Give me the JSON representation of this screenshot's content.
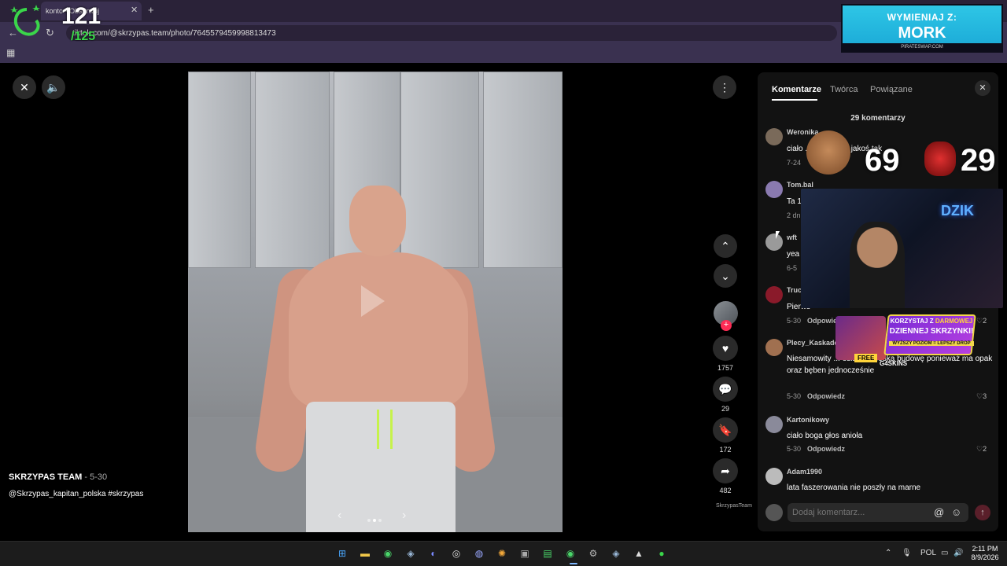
{
  "browser": {
    "tab_title": "konto • Obserwuj",
    "url": "tiktok.com/@skrzypas.team/photo/7645579459998813473"
  },
  "overlay_counter": {
    "big": "121",
    "small": "/125"
  },
  "banner": {
    "line1": "WYMIENIAJ Z:",
    "line2": "MORK",
    "footer": "PIRATESWAP.COM"
  },
  "post": {
    "author": "SKRZYPAS TEAM",
    "date": " - 5-30",
    "caption": "@Skrzypas_kapitan_polska #skrzypas"
  },
  "actions": {
    "likes": "1757",
    "comments": "29",
    "saves": "172",
    "shares": "482",
    "music_label": "SkrzypasTeam"
  },
  "panel": {
    "tabs": [
      "Komentarze",
      "Twórca",
      "Powiązane"
    ],
    "count": "29 komentarzy",
    "reply_label": "Odpowiedz",
    "input_placeholder": "Dodaj komentarz...",
    "comments": [
      {
        "user": "Weronika",
        "text": "ciało ... anioła czy jakoś tak",
        "meta": "7-24",
        "likes": ""
      },
      {
        "user": "Tom.bal",
        "text": "Ta 1",
        "meta": "2 dni",
        "likes": ""
      },
      {
        "user": "wft",
        "text": "yea",
        "meta": "6-5",
        "likes": ""
      },
      {
        "user": "Truc",
        "text": "Pierws",
        "meta": "5-30",
        "likes": "2"
      },
      {
        "user": "Plecy_Kaskader",
        "text": "Niesamowity ... osiągnął boską budowę ponieważ ma opak oraz bęben jednocześnie",
        "meta": "5-30",
        "likes": "3"
      },
      {
        "user": "Kartonikowy",
        "text": "ciało boga głos anioła",
        "meta": "5-30",
        "likes": "2"
      },
      {
        "user": "Adam1990",
        "text": "lata faszerowania nie poszły na marne",
        "meta": "",
        "likes": ""
      }
    ]
  },
  "stream": {
    "score_a": "69",
    "score_b": "29",
    "webcam_sign": "DZIK",
    "promo_line1_a": "KORZYSTAJ Z ",
    "promo_line1_b": "DARMOWEJ",
    "promo_line2": "DZIENNEJ SKRZYNKI!",
    "promo_line3": "WYŻSZY POZIOM = LEPSZY DROP",
    "promo_free": "FREE",
    "promo_brand": "G4SKINS"
  },
  "taskbar": {
    "lang": "POL",
    "time": "2:11 PM",
    "date": "8/9/2026"
  },
  "colors": {
    "tiktok_red": "#fe2c55",
    "overlay_green": "#3ad64a",
    "banner_cyan": "#2ec6e6"
  }
}
